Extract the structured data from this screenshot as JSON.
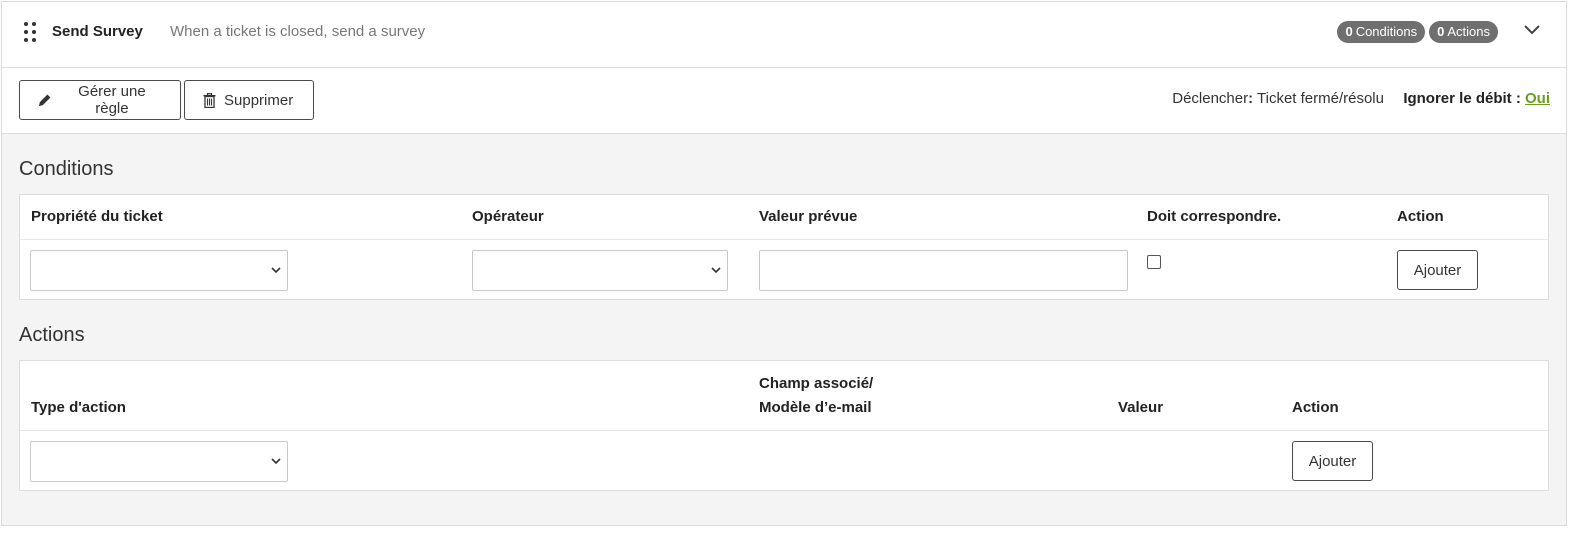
{
  "rule": {
    "name": "Send Survey",
    "description": "When a ticket is closed, send a survey",
    "conditions_count": "0",
    "conditions_label": "Conditions",
    "actions_count": "0",
    "actions_label": "Actions"
  },
  "toolbar": {
    "edit_label": "Gérer une règle",
    "delete_label": "Supprimer",
    "trigger_label": "Déclencher",
    "trigger_sep": ":",
    "trigger_value": " Ticket fermé/résolu",
    "ignore_label": "Ignorer le débit : ",
    "ignore_value": "Oui"
  },
  "conditions": {
    "title": "Conditions",
    "headers": {
      "property": "Propriété du ticket",
      "operator": "Opérateur",
      "expected": "Valeur prévue",
      "must_match": "Doit correspondre.",
      "action": "Action"
    },
    "add_label": "Ajouter"
  },
  "actions": {
    "title": "Actions",
    "headers": {
      "type": "Type d'action",
      "field_line1": "Champ associé/",
      "field_line2": "Modèle d’e-mail",
      "value": "Valeur",
      "action": "Action"
    },
    "add_label": "Ajouter"
  },
  "colors": {
    "badge_bg": "#6f6f6f",
    "link_green": "#6a9e1f",
    "panel_bg": "#f4f4f4"
  },
  "icons": {
    "drag": "drag-handle-icon",
    "chevron": "chevron-down-icon",
    "edit": "pencil-icon",
    "delete": "trash-icon"
  }
}
